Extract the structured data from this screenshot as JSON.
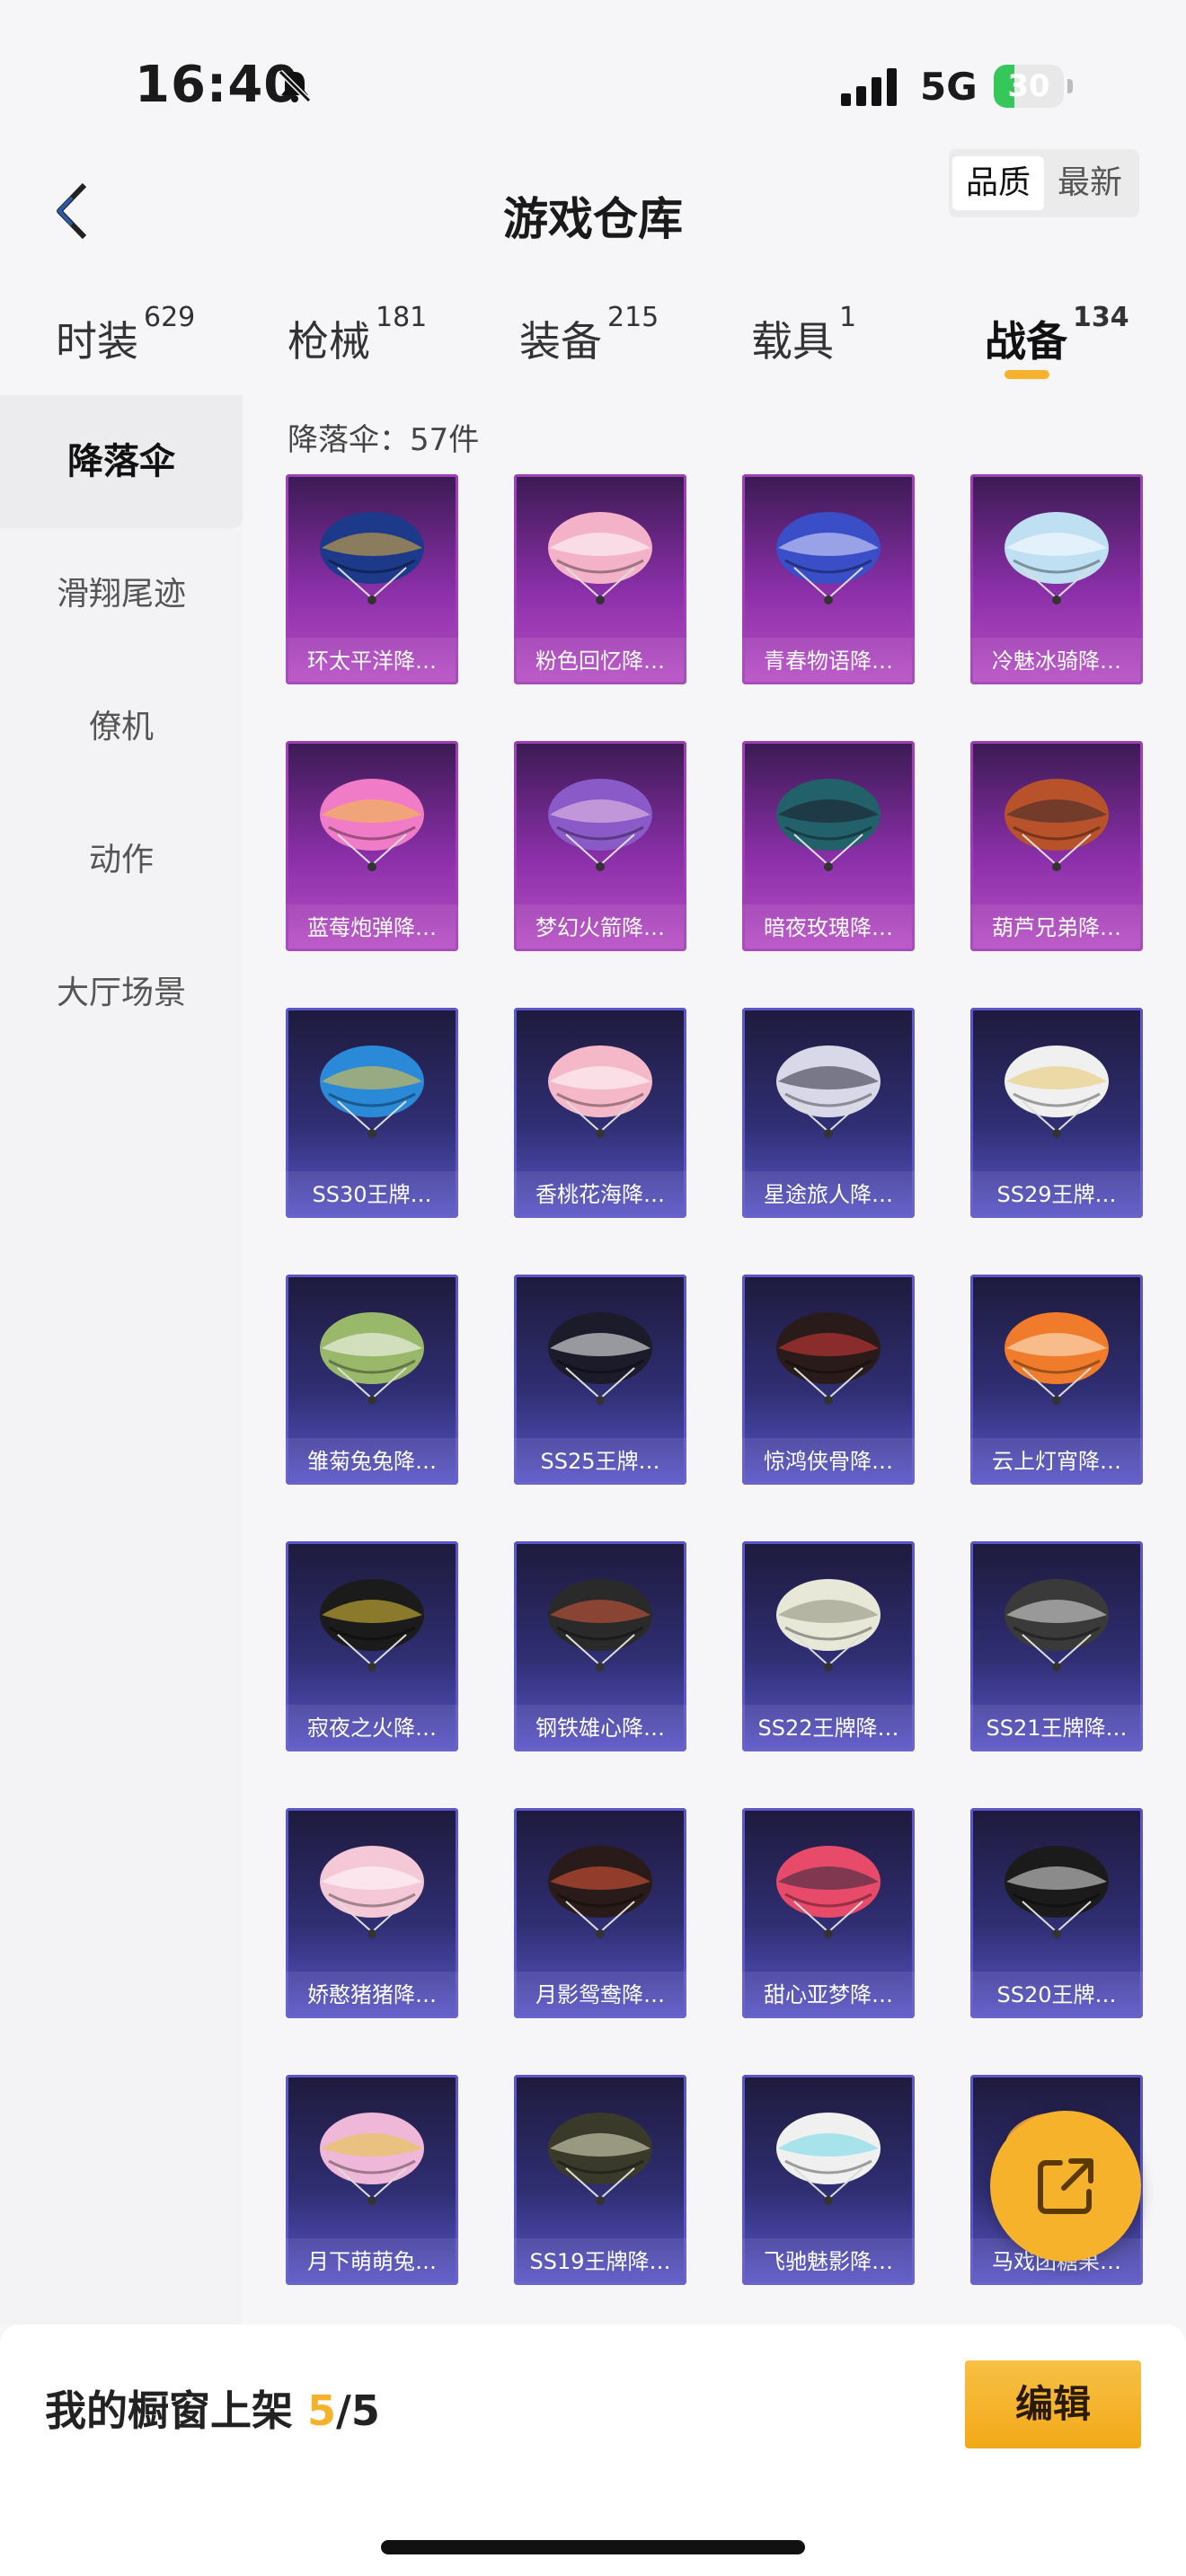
{
  "status_bar": {
    "time": "16:40",
    "network": "5G",
    "battery": "30",
    "battery_level": 0.3
  },
  "header": {
    "back_icon": "chevron-left-icon",
    "title": "游戏仓库",
    "sort": [
      "品质",
      "最新"
    ]
  },
  "category_tabs": [
    {
      "label": "时装",
      "count": "629"
    },
    {
      "label": "枪械",
      "count": "181"
    },
    {
      "label": "装备",
      "count": "215"
    },
    {
      "label": "载具",
      "count": "1"
    },
    {
      "label": "战备",
      "count": "134"
    }
  ],
  "sidebar": [
    "降落伞",
    "滑翔尾迹",
    "僚机",
    "动作",
    "大厅场景"
  ],
  "list": {
    "count_label": "降落伞：57件"
  },
  "items": [
    {
      "name": "环太平洋降…",
      "tier": "purple",
      "colors": [
        "#1d3a8a",
        "#e8b33a"
      ]
    },
    {
      "name": "粉色回忆降…",
      "tier": "purple",
      "colors": [
        "#f3b2c8",
        "#ffffff"
      ]
    },
    {
      "name": "青春物语降…",
      "tier": "purple",
      "colors": [
        "#3a4ec8",
        "#e8e8ff"
      ]
    },
    {
      "name": "冷魅冰骑降…",
      "tier": "purple",
      "colors": [
        "#bfe0f3",
        "#ffffff"
      ]
    },
    {
      "name": "蓝莓炮弹降…",
      "tier": "purple",
      "colors": [
        "#f07bc6",
        "#f3c43a"
      ]
    },
    {
      "name": "梦幻火箭降…",
      "tier": "purple",
      "colors": [
        "#8a5bc8",
        "#f0c8e8"
      ]
    },
    {
      "name": "暗夜玫瑰降…",
      "tier": "purple",
      "colors": [
        "#22606a",
        "#1b1b2a"
      ]
    },
    {
      "name": "葫芦兄弟降…",
      "tier": "purple",
      "colors": [
        "#b8522a",
        "#3a2a2a"
      ]
    },
    {
      "name": "SS30王牌…",
      "tier": "blue",
      "colors": [
        "#2a8ad8",
        "#f3c43a"
      ]
    },
    {
      "name": "香桃花海降…",
      "tier": "blue",
      "colors": [
        "#f5b8c8",
        "#ffffff"
      ]
    },
    {
      "name": "星途旅人降…",
      "tier": "blue",
      "colors": [
        "#d8d8e8",
        "#2a2a3a"
      ]
    },
    {
      "name": "SS29王牌…",
      "tier": "blue",
      "colors": [
        "#f0f0f0",
        "#e8c86a"
      ]
    },
    {
      "name": "雏菊兔兔降…",
      "tier": "blue",
      "colors": [
        "#9ab86a",
        "#ffffff"
      ]
    },
    {
      "name": "SS25王牌…",
      "tier": "blue",
      "colors": [
        "#1b1b2a",
        "#ffffff"
      ]
    },
    {
      "name": "惊鸿侠骨降…",
      "tier": "blue",
      "colors": [
        "#2a1b1b",
        "#d83a3a"
      ]
    },
    {
      "name": "云上灯宵降…",
      "tier": "blue",
      "colors": [
        "#f07b2a",
        "#fff0d8"
      ]
    },
    {
      "name": "寂夜之火降…",
      "tier": "blue",
      "colors": [
        "#1b1b1b",
        "#e8c83a"
      ]
    },
    {
      "name": "钢铁雄心降…",
      "tier": "blue",
      "colors": [
        "#2a2a2a",
        "#d85a3a"
      ]
    },
    {
      "name": "SS22王牌降…",
      "tier": "blue",
      "colors": [
        "#e8e8d8",
        "#8a8a7a"
      ]
    },
    {
      "name": "SS21王牌降…",
      "tier": "blue",
      "colors": [
        "#3a3a3a",
        "#e8e8e8"
      ]
    },
    {
      "name": "娇憨猪猪降…",
      "tier": "blue",
      "colors": [
        "#f5c8d8",
        "#ffffff"
      ]
    },
    {
      "name": "月影鸳鸯降…",
      "tier": "blue",
      "colors": [
        "#2a1b1b",
        "#e85a3a"
      ]
    },
    {
      "name": "甜心亚梦降…",
      "tier": "blue",
      "colors": [
        "#e84a6a",
        "#2a2a3a"
      ]
    },
    {
      "name": "SS20王牌…",
      "tier": "blue",
      "colors": [
        "#1b1b1b",
        "#e8e8e8"
      ]
    },
    {
      "name": "月下萌萌兔…",
      "tier": "blue",
      "colors": [
        "#f0b8d8",
        "#e8c83a"
      ]
    },
    {
      "name": "SS19王牌降…",
      "tier": "blue",
      "colors": [
        "#3a3a2a",
        "#e8e8c8"
      ]
    },
    {
      "name": "飞驰魅影降…",
      "tier": "blue",
      "colors": [
        "#f0f0f0",
        "#6ad8e8"
      ]
    },
    {
      "name": "马戏团糖果…",
      "tier": "blue",
      "colors": [
        "#f0a040",
        "#ffffff"
      ]
    }
  ],
  "fab": {
    "icon": "share-icon"
  },
  "bottom": {
    "label": "我的橱窗上架",
    "current": "5",
    "total": "/5",
    "edit": "编辑"
  }
}
